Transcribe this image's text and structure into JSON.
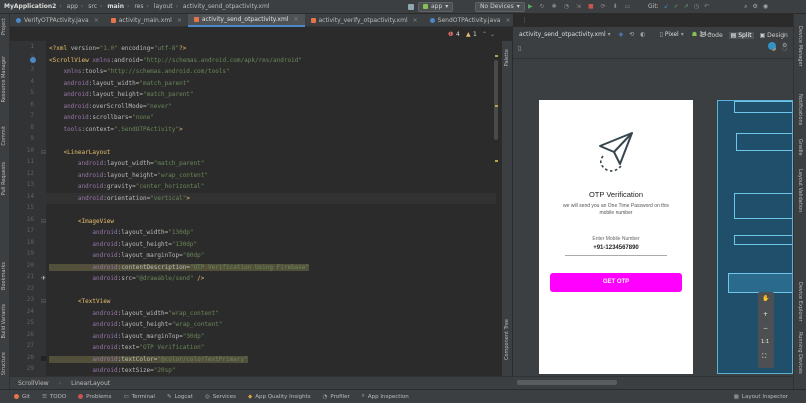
{
  "breadcrumbs": [
    "MyApplication2",
    "app",
    "src",
    "main",
    "res",
    "layout",
    "activity_send_otpactivity.xml"
  ],
  "toolbar": {
    "run_config": "app",
    "device": "No Devices",
    "git_label": "Git:"
  },
  "tabs": [
    {
      "label": "VerifyOTPActivity.java",
      "active": false
    },
    {
      "label": "activity_main.xml",
      "active": false
    },
    {
      "label": "activity_send_otpactivity.xml",
      "active": true
    },
    {
      "label": "activity_verify_otpactivity.xml",
      "active": false
    },
    {
      "label": "SendOTPActivity.java",
      "active": false
    }
  ],
  "editor": {
    "warnings": "1",
    "errors": "4",
    "line_numbers": [
      "1",
      "2",
      "3",
      "4",
      "5",
      "6",
      "7",
      "8",
      "9",
      "10",
      "11",
      "12",
      "13",
      "14",
      "15",
      "16",
      "17",
      "18",
      "19",
      "20",
      "21",
      "22",
      "23",
      "24",
      "25",
      "26",
      "27",
      "28",
      "29"
    ],
    "lines": [
      "<?xml version=\"1.0\" encoding=\"utf-8\"?>",
      "<ScrollView xmlns:android=\"http://schemas.android.com/apk/res/android\"",
      "    xmlns:tools=\"http://schemas.android.com/tools\"",
      "    android:layout_width=\"match_parent\"",
      "    android:layout_height=\"match_parent\"",
      "    android:overScrollMode=\"never\"",
      "    android:scrollbars=\"none\"",
      "    tools:context=\".SendOTPActivity\">",
      "",
      "    <LinearLayout",
      "        android:layout_width=\"match_parent\"",
      "        android:layout_height=\"wrap_content\"",
      "        android:gravity=\"center_horizontal\"",
      "        android:orientation=\"vertical\">",
      "",
      "        <ImageView",
      "            android:layout_width=\"130dp\"",
      "            android:layout_height=\"130dp\"",
      "            android:layout_marginTop=\"80dp\"",
      "            android:contentDescription=\"OTP Verification Using Firebase\"",
      "            android:src=\"@drawable/send\" />",
      "",
      "        <TextView",
      "            android:layout_width=\"wrap_content\"",
      "            android:layout_height=\"wrap_content\"",
      "            android:layout_marginTop=\"30dp\"",
      "            android:text=\"OTP Verification\"",
      "            android:textColor=\"@color/colorTextPrimary\"",
      "            android:textSize=\"20sp\""
    ]
  },
  "design": {
    "file_tab": "activity_send_otpactivity.xml",
    "modes": {
      "code": "Code",
      "split": "Split",
      "design": "Design"
    },
    "device": "Pixel",
    "api": "34"
  },
  "phone": {
    "title": "OTP Verification",
    "subtitle": "we will send you an One Time Password on this mobile number",
    "input_hint": "Enter Mobile Number",
    "phone_value": "+91-1234567890",
    "button_label": "GET OTP"
  },
  "crumbbar": {
    "items": [
      "ScrollView",
      "LinearLayout"
    ]
  },
  "left_tools": [
    "Project",
    "Resource Manager",
    "Commit",
    "Pull Requests",
    "Bookmarks",
    "Build Variants",
    "Structure"
  ],
  "right_tools": [
    "Device Manager",
    "Notifications",
    "Gradle",
    "Layout Validation",
    "Device Explorer",
    "Running Devices"
  ],
  "palette_labels": [
    "Palette",
    "Component Tree"
  ],
  "statusbar": {
    "items": [
      "Git",
      "TODO",
      "Problems",
      "Terminal",
      "Logcat",
      "Services",
      "App Quality Insights",
      "Profiler",
      "App Inspection"
    ],
    "right": "Layout Inspector"
  },
  "colors": {
    "accent": "#ff00ff",
    "tab_underline": "#4a88c7",
    "blueprint": "#1f4f6b"
  }
}
